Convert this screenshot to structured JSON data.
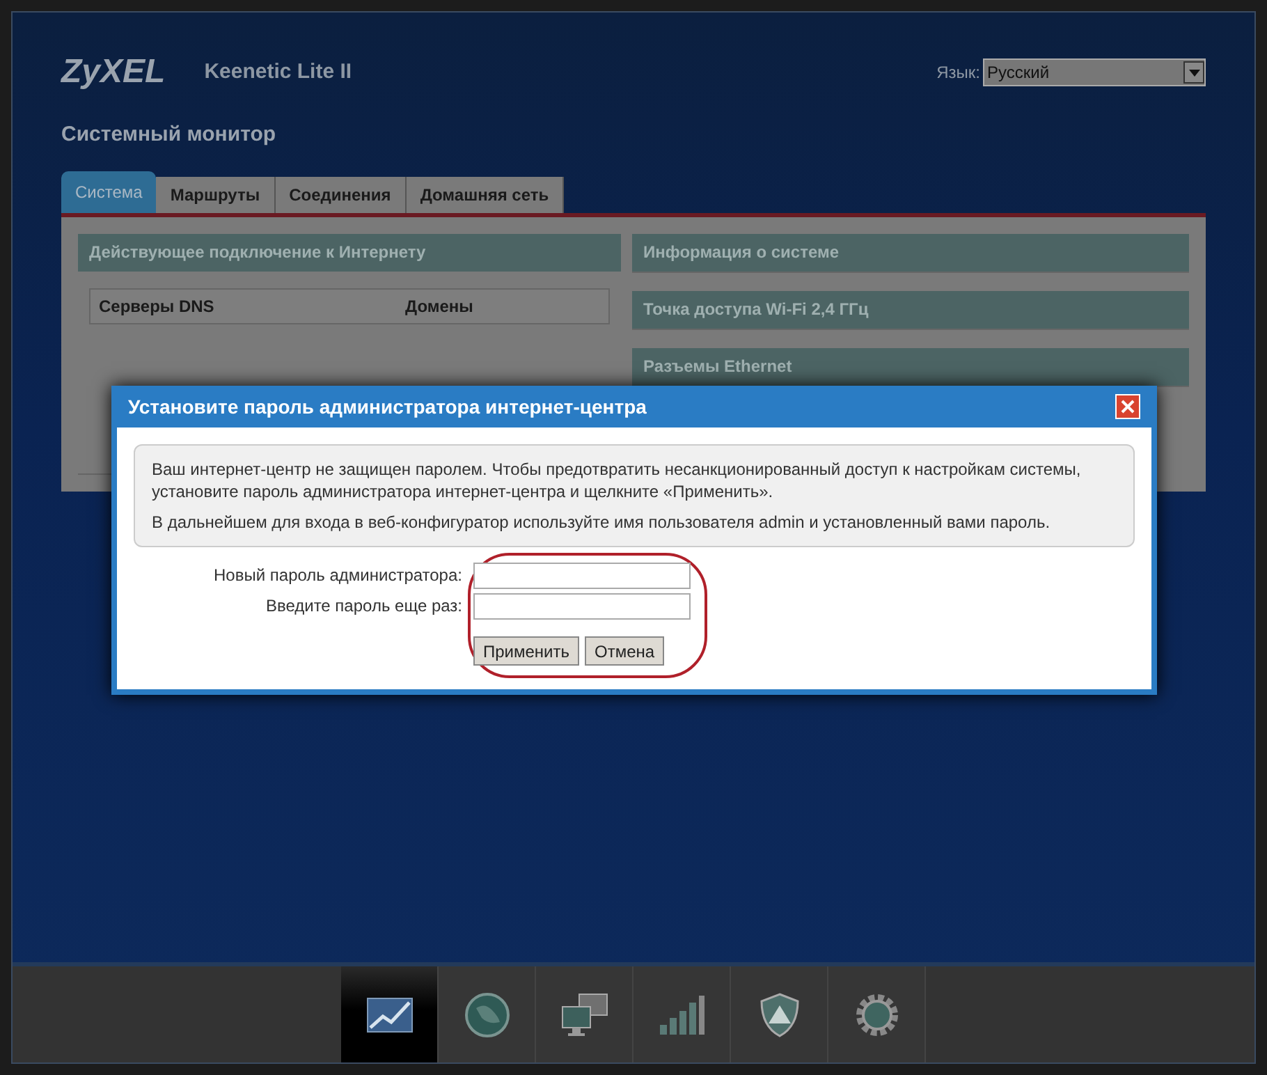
{
  "header": {
    "logo": "ZyXEL",
    "model": "Keenetic Lite II",
    "language_label": "Язык:",
    "language_value": "Русский"
  },
  "page_title": "Системный монитор",
  "tabs": [
    {
      "label": "Система",
      "selected": true
    },
    {
      "label": "Маршруты",
      "selected": false
    },
    {
      "label": "Соединения",
      "selected": false
    },
    {
      "label": "Домашняя сеть",
      "selected": false
    }
  ],
  "left_panel": {
    "title": "Действующее подключение к Интернету",
    "columns": [
      "Серверы DNS",
      "Домены"
    ]
  },
  "right_panels": [
    "Информация о системе",
    "Точка доступа Wi-Fi 2,4 ГГц",
    "Разъемы Ethernet"
  ],
  "dialog": {
    "title": "Установите пароль администратора интернет-центра",
    "paragraphs": [
      "Ваш интернет-центр не защищен паролем. Чтобы предотвратить несанкционированный доступ к настройкам системы, установите пароль администратора интернет-центра и щелкните «Применить».",
      "В дальнейшем для входа в веб-конфигуратор используйте имя пользователя admin и установленный вами пароль."
    ],
    "fields": [
      {
        "label": "Новый пароль администратора:"
      },
      {
        "label": "Введите пароль еще раз:"
      }
    ],
    "buttons": [
      "Применить",
      "Отмена"
    ]
  },
  "dock": [
    {
      "kind": "chart",
      "selected": true
    },
    {
      "kind": "globe",
      "selected": false
    },
    {
      "kind": "computers",
      "selected": false
    },
    {
      "kind": "signal",
      "selected": false
    },
    {
      "kind": "shield",
      "selected": false
    },
    {
      "kind": "gear",
      "selected": false
    }
  ]
}
